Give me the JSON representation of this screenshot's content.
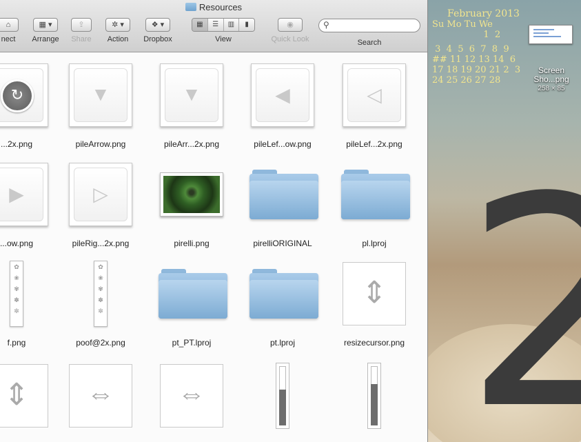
{
  "window": {
    "title": "Resources"
  },
  "toolbar": {
    "connect_label": "nect",
    "arrange_label": "Arrange",
    "share_label": "Share",
    "action_label": "Action",
    "dropbox_label": "Dropbox",
    "view_label": "View",
    "quicklook_label": "Quick Look",
    "search_label": "Search",
    "search_placeholder": ""
  },
  "files": [
    {
      "name": "...2x.png",
      "icon": "circle-arrow-icon"
    },
    {
      "name": "pileArrow.png",
      "icon": "frame-arrow-down-icon"
    },
    {
      "name": "pileArr...2x.png",
      "icon": "frame-arrow-down-icon"
    },
    {
      "name": "pileLef...ow.png",
      "icon": "frame-arrow-left-icon"
    },
    {
      "name": "pileLef...2x.png",
      "icon": "frame-arrow-left-icon"
    },
    {
      "name": "...ow.png",
      "icon": "frame-arrow-right-icon"
    },
    {
      "name": "pileRig...2x.png",
      "icon": "frame-arrow-right-icon"
    },
    {
      "name": "pirelli.png",
      "icon": "photo-icon"
    },
    {
      "name": "pirelliORIGINAL",
      "icon": "folder-icon"
    },
    {
      "name": "pl.lproj",
      "icon": "folder-icon"
    },
    {
      "name": "f.png",
      "icon": "strip-icon"
    },
    {
      "name": "poof@2x.png",
      "icon": "strip-icon"
    },
    {
      "name": "pt_PT.lproj",
      "icon": "folder-icon"
    },
    {
      "name": "pt.lproj",
      "icon": "folder-icon"
    },
    {
      "name": "resizecursor.png",
      "icon": "resize-vertical-icon"
    },
    {
      "name": "",
      "icon": "resize-vertical-icon"
    },
    {
      "name": "",
      "icon": "resize-horizontal-icon"
    },
    {
      "name": "",
      "icon": "resize-horizontal-icon"
    },
    {
      "name": "",
      "icon": "level-bar-icon"
    },
    {
      "name": "",
      "icon": "level-bar-icon"
    }
  ],
  "calendar": {
    "title": "February 2013",
    "rows": [
      "Su Mo Tu We",
      "                  1  2",
      " 3  4  5  6  7  8  9",
      "## 11 12 13 14  6",
      "17 18 19 20 21 2  3",
      "24 25 26 27 28"
    ]
  },
  "desktop": {
    "big_digit": "2",
    "screenshot_label_1": "Screen",
    "screenshot_label_2": "Sho...png",
    "screenshot_dims": "258 × 85"
  }
}
